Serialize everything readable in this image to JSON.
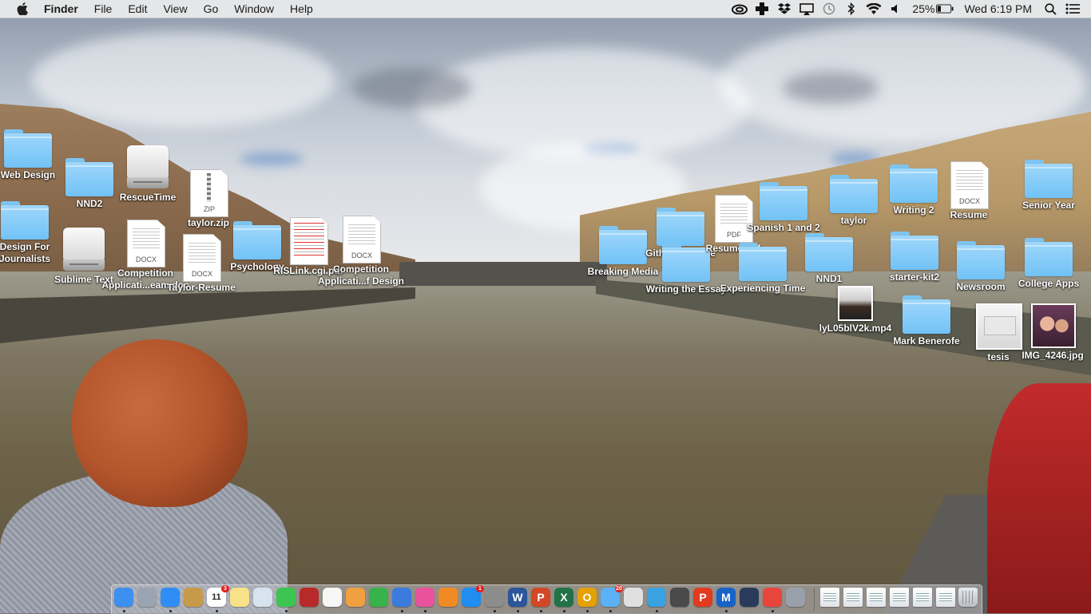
{
  "menubar": {
    "app": "Finder",
    "menus": [
      "File",
      "Edit",
      "View",
      "Go",
      "Window",
      "Help"
    ],
    "status_icons": [
      "creative-cloud-icon",
      "plus-cross-icon",
      "dropbox-icon",
      "airplay-icon",
      "time-machine-icon",
      "bluetooth-icon",
      "wifi-icon",
      "volume-icon"
    ],
    "battery_percent": "25%",
    "clock": "Wed 6:19 PM"
  },
  "desktop": {
    "items": [
      {
        "label": "Web Design",
        "kind": "folder"
      },
      {
        "label": "NND2",
        "kind": "folder"
      },
      {
        "label": "RescueTime",
        "kind": "drive"
      },
      {
        "label": "taylor.zip",
        "kind": "zip",
        "badge": "ZIP"
      },
      {
        "label": "Design For",
        "label2": "Journalists",
        "kind": "folder"
      },
      {
        "label": "Sublime Text",
        "kind": "drive"
      },
      {
        "label": "Competition",
        "label2": "Applicati...eam.doc",
        "kind": "docx",
        "badge": "DOCX"
      },
      {
        "label": "Taylor-Resume",
        "kind": "docx",
        "badge": "DOCX"
      },
      {
        "label": "Psychology",
        "kind": "folder"
      },
      {
        "label": "RISLink.cgi.pdf",
        "kind": "pdfthumb"
      },
      {
        "label": "Competition",
        "label2": "Applicati...f Design",
        "kind": "docx",
        "badge": "DOCX"
      },
      {
        "label": "Breaking Media",
        "kind": "folder"
      },
      {
        "label": "Github Website",
        "kind": "folder"
      },
      {
        "label": "Writing the Essay",
        "kind": "folder"
      },
      {
        "label": "Resume.pdf",
        "kind": "pdf",
        "badge": "PDF"
      },
      {
        "label": "Spanish 1 and 2",
        "kind": "folder"
      },
      {
        "label": "Experiencing Time",
        "kind": "folder"
      },
      {
        "label": "taylor",
        "kind": "folder"
      },
      {
        "label": "NND1",
        "kind": "folder"
      },
      {
        "label": "lyL05blV2k.mp4",
        "kind": "video"
      },
      {
        "label": "Writing 2",
        "kind": "folder"
      },
      {
        "label": "starter-kit2",
        "kind": "folder"
      },
      {
        "label": "Mark Benerofe",
        "kind": "folder"
      },
      {
        "label": "Resume",
        "kind": "docx",
        "badge": "DOCX"
      },
      {
        "label": "Newsroom",
        "kind": "folder"
      },
      {
        "label": "tesis",
        "kind": "image"
      },
      {
        "label": "Senior Year",
        "kind": "folder"
      },
      {
        "label": "College Apps",
        "kind": "folder"
      },
      {
        "label": "IMG_4246.jpg",
        "kind": "photo"
      }
    ]
  },
  "dock": {
    "apps": [
      {
        "name": "finder-icon",
        "color": "#3d8ff0"
      },
      {
        "name": "launchpad-icon",
        "color": "#9aa4b0"
      },
      {
        "name": "safari-icon",
        "color": "#2f8ef5"
      },
      {
        "name": "notebook-icon",
        "color": "#c79a4a"
      },
      {
        "name": "calendar-icon",
        "color": "#ffffff",
        "glyph": "11",
        "badge": "3"
      },
      {
        "name": "notes-icon",
        "color": "#f7e28a"
      },
      {
        "name": "preview-icon",
        "color": "#d7e3ef"
      },
      {
        "name": "facetime-icon",
        "color": "#3cc651"
      },
      {
        "name": "photo-booth-icon",
        "color": "#b82a2a"
      },
      {
        "name": "photos-icon",
        "color": "#f6f6f6"
      },
      {
        "name": "pages-icon",
        "color": "#f0a040"
      },
      {
        "name": "numbers-icon",
        "color": "#38b24a"
      },
      {
        "name": "keynote-icon",
        "color": "#3b7bdc"
      },
      {
        "name": "itunes-icon",
        "color": "#e9529c"
      },
      {
        "name": "ibooks-icon",
        "color": "#f08a24"
      },
      {
        "name": "app-store-icon",
        "color": "#1f8ef0",
        "badge": "1"
      },
      {
        "name": "system-preferences-icon",
        "color": "#8c8c8c"
      },
      {
        "name": "word-icon",
        "color": "#2b579a",
        "glyph": "W"
      },
      {
        "name": "powerpoint-icon",
        "color": "#d24726",
        "glyph": "P"
      },
      {
        "name": "excel-icon",
        "color": "#217346",
        "glyph": "X"
      },
      {
        "name": "outlook-icon",
        "color": "#e5a100",
        "glyph": "O"
      },
      {
        "name": "messages-icon",
        "color": "#5ab1f5",
        "badge": "20"
      },
      {
        "name": "self-service-icon",
        "color": "#e0e0e0"
      },
      {
        "name": "network-icon",
        "color": "#3aa2e0"
      },
      {
        "name": "terminal-icon",
        "color": "#4a4a4a"
      },
      {
        "name": "acrobat-icon",
        "color": "#e13b20",
        "glyph": "P"
      },
      {
        "name": "m-app-icon",
        "color": "#1764c8",
        "glyph": "M"
      },
      {
        "name": "window-app-icon",
        "color": "#2a3a5a"
      },
      {
        "name": "chrome-icon",
        "color": "#e8453c"
      },
      {
        "name": "device-icon",
        "color": "#9aa0aa"
      }
    ],
    "stack": [
      "document-stack-icon",
      "screenshot-stack-icon",
      "screenshot-stack-icon",
      "screenshot-stack-icon",
      "screenshot-stack-icon",
      "screenshot-stack-icon"
    ],
    "trash": "trash-icon"
  }
}
